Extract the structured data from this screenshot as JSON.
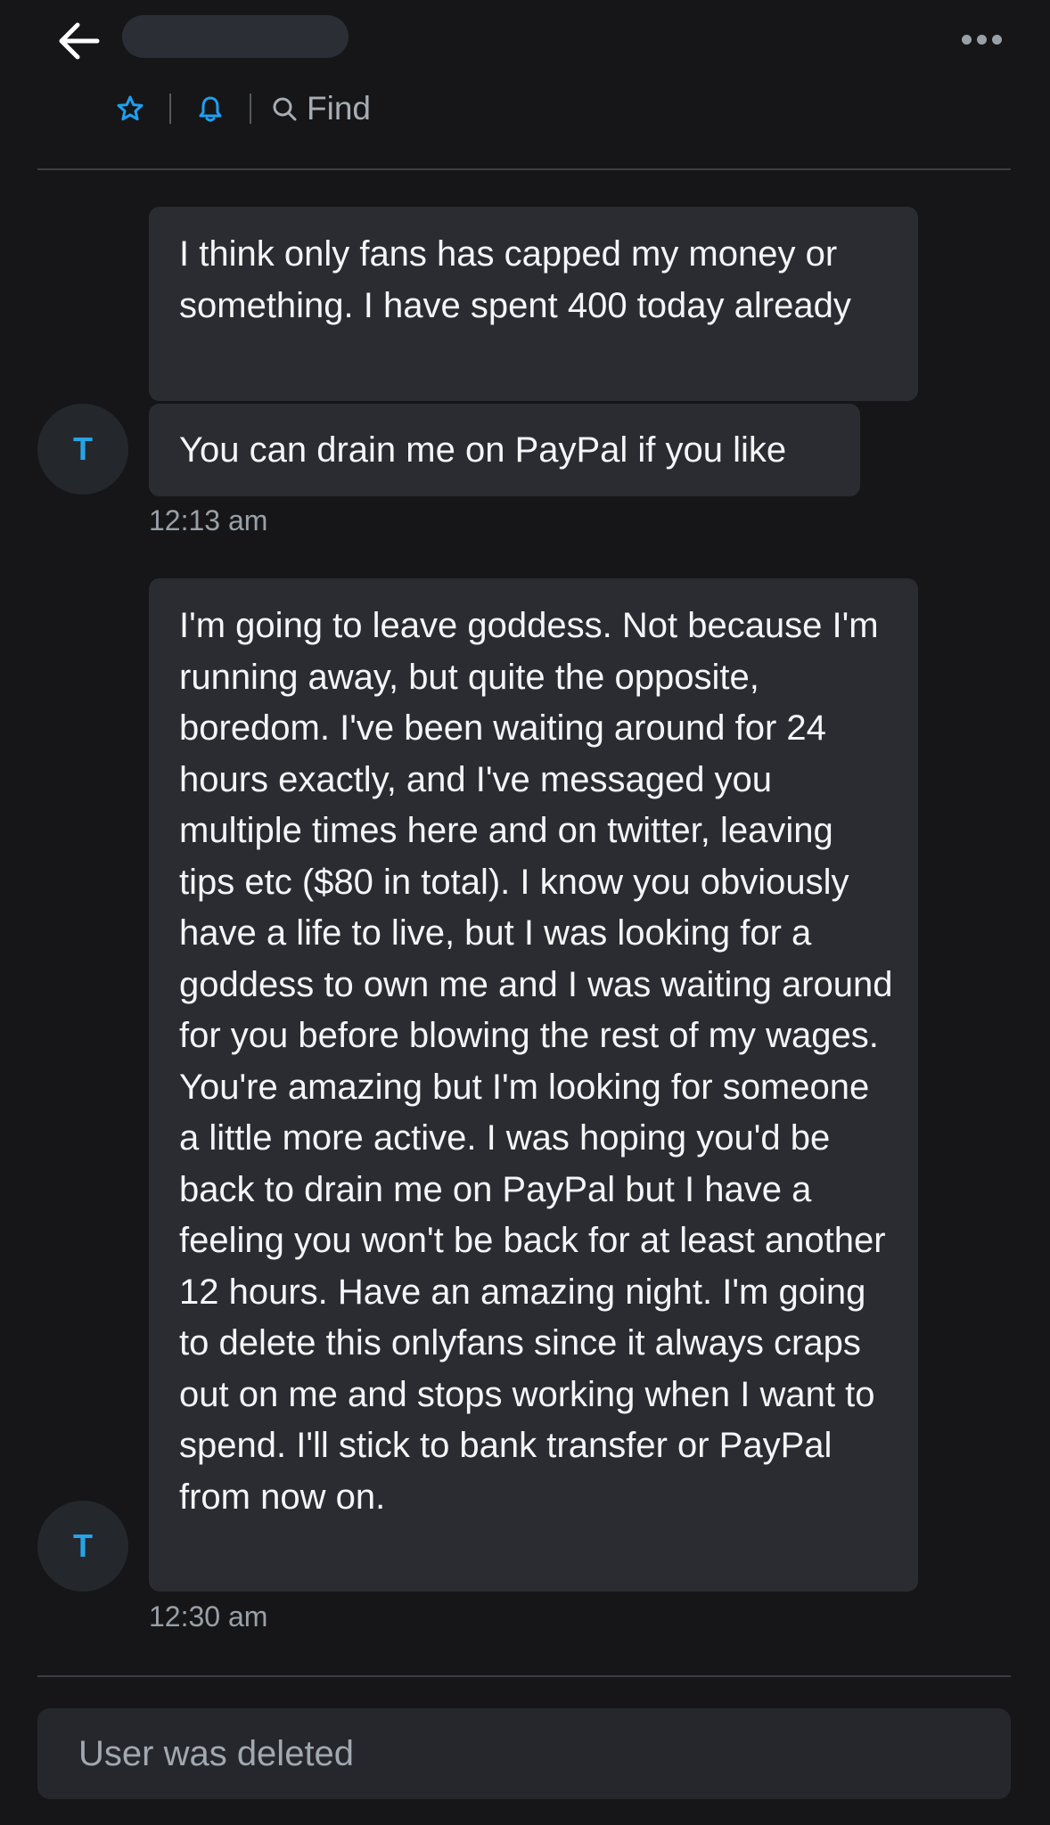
{
  "header": {
    "find_label": "Find",
    "icons": [
      "back-arrow-icon",
      "star-icon",
      "bell-icon",
      "search-icon",
      "more-icon"
    ],
    "accent_color": "#1da1f2"
  },
  "messages": [
    {
      "avatar_initial": "T",
      "bubbles": [
        "I think only fans has capped my money or something. I have spent 400 today already",
        "You can drain me on PayPal if you like"
      ],
      "time": "12:13 am"
    },
    {
      "avatar_initial": "T",
      "bubbles": [
        "I'm going to leave goddess. Not because I'm running away, but quite the opposite, boredom. I've been waiting around for 24 hours exactly, and I've messaged you multiple times here and on twitter, leaving tips etc ($80 in total). I know you obviously have a life to live, but I was looking for a goddess to own me and I was waiting around for you before blowing the rest of my wages. You're amazing but I'm looking for someone a little more active. I was hoping you'd be back to drain me on PayPal but I have a feeling you won't be back for at least another 12 hours. Have an amazing night. I'm going to delete this onlyfans since it always craps out on me and stops working when I want to spend. I'll stick to bank transfer or PayPal from now on."
      ],
      "time": "12:30 am"
    }
  ],
  "composer": {
    "status_text": "User was deleted"
  }
}
